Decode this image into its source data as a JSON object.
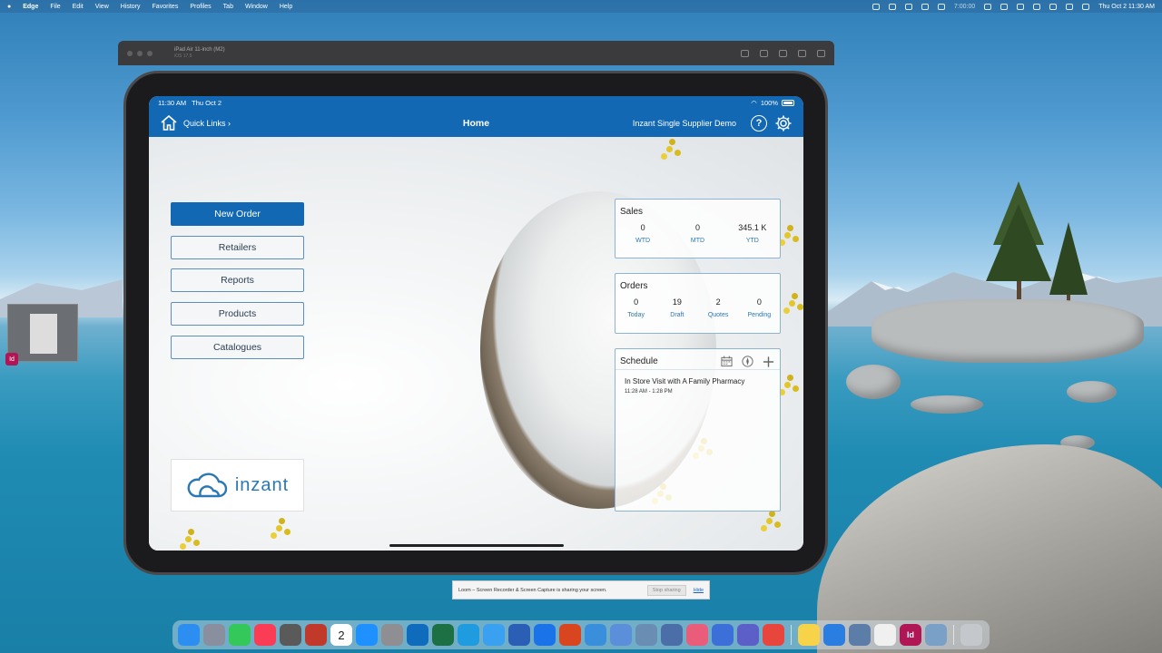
{
  "menubar": {
    "app_name": "Edge",
    "items": [
      "File",
      "Edit",
      "View",
      "History",
      "Favorites",
      "Profiles",
      "Tab",
      "Window",
      "Help"
    ],
    "right_status": "7:00:00",
    "datetime": "Thu Oct 2  11:30 AM"
  },
  "simulator": {
    "device_name": "iPad Air 11-inch (M2)",
    "os_version": "iOS 17.5"
  },
  "ipad": {
    "status_time": "11:30 AM",
    "status_date": "Thu Oct 2",
    "battery": "100%",
    "nav": {
      "quick_links": "Quick Links ›",
      "title": "Home",
      "org_name": "Inzant Single Supplier Demo",
      "help_symbol": "?"
    },
    "menu": [
      "New Order",
      "Retailers",
      "Reports",
      "Products",
      "Catalogues"
    ],
    "logo_text": "inzant",
    "sales": {
      "title": "Sales",
      "stats": [
        {
          "value": "0",
          "label": "WTD"
        },
        {
          "value": "0",
          "label": "MTD"
        },
        {
          "value": "345.1 K",
          "label": "YTD"
        }
      ]
    },
    "orders": {
      "title": "Orders",
      "stats": [
        {
          "value": "0",
          "label": "Today"
        },
        {
          "value": "19",
          "label": "Draft"
        },
        {
          "value": "2",
          "label": "Quotes"
        },
        {
          "value": "0",
          "label": "Pending"
        }
      ]
    },
    "schedule": {
      "title": "Schedule",
      "events": [
        {
          "title": "In Store Visit with A Family Pharmacy",
          "time": "11:28 AM - 1:28 PM"
        }
      ]
    }
  },
  "side_badge": "Id",
  "loom": {
    "message": "Loom – Screen Recorder & Screen Capture is sharing your screen.",
    "stop_label": "Stop sharing",
    "hide_label": "Hide"
  },
  "dock": {
    "calendar_day": "2",
    "apps": [
      {
        "name": "finder",
        "color": "#2c8ef0"
      },
      {
        "name": "launchpad",
        "color": "#8a8fa0"
      },
      {
        "name": "messages",
        "color": "#34c759"
      },
      {
        "name": "music",
        "color": "#fa3c55"
      },
      {
        "name": "calculator",
        "color": "#5a5a5a"
      },
      {
        "name": "photo-booth",
        "color": "#c0392b"
      },
      {
        "name": "calendar",
        "color": "#ffffff"
      },
      {
        "name": "app-store",
        "color": "#1e90ff"
      },
      {
        "name": "system-settings",
        "color": "#8e8e93"
      },
      {
        "name": "outlook",
        "color": "#0f6cbd"
      },
      {
        "name": "excel",
        "color": "#1d7044"
      },
      {
        "name": "edge",
        "color": "#1f9be0"
      },
      {
        "name": "safari",
        "color": "#3aa0f0"
      },
      {
        "name": "word",
        "color": "#2b5fb5"
      },
      {
        "name": "teams-grid",
        "color": "#1a73e8"
      },
      {
        "name": "remote-desktop",
        "color": "#d9451e"
      },
      {
        "name": "files",
        "color": "#3a8fdc"
      },
      {
        "name": "simulator",
        "color": "#5b8fd9"
      },
      {
        "name": "loom",
        "color": "#6a8db4"
      },
      {
        "name": "preview",
        "color": "#4b6ea8"
      },
      {
        "name": "feedback",
        "color": "#e95d7b"
      },
      {
        "name": "notes-app",
        "color": "#3d6fd8"
      },
      {
        "name": "teams",
        "color": "#5b5fc7"
      },
      {
        "name": "chrome",
        "color": "#e8453c"
      },
      {
        "name": "notes",
        "color": "#f7d34a"
      },
      {
        "name": "keynote",
        "color": "#2a7de1"
      },
      {
        "name": "finder-2",
        "color": "#5b7da8"
      },
      {
        "name": "textedit",
        "color": "#f0f0f0"
      },
      {
        "name": "indesign",
        "color": "#b01655"
      },
      {
        "name": "activity",
        "color": "#7aa0c8"
      },
      {
        "name": "trash",
        "color": "#c4c8cc"
      }
    ]
  }
}
